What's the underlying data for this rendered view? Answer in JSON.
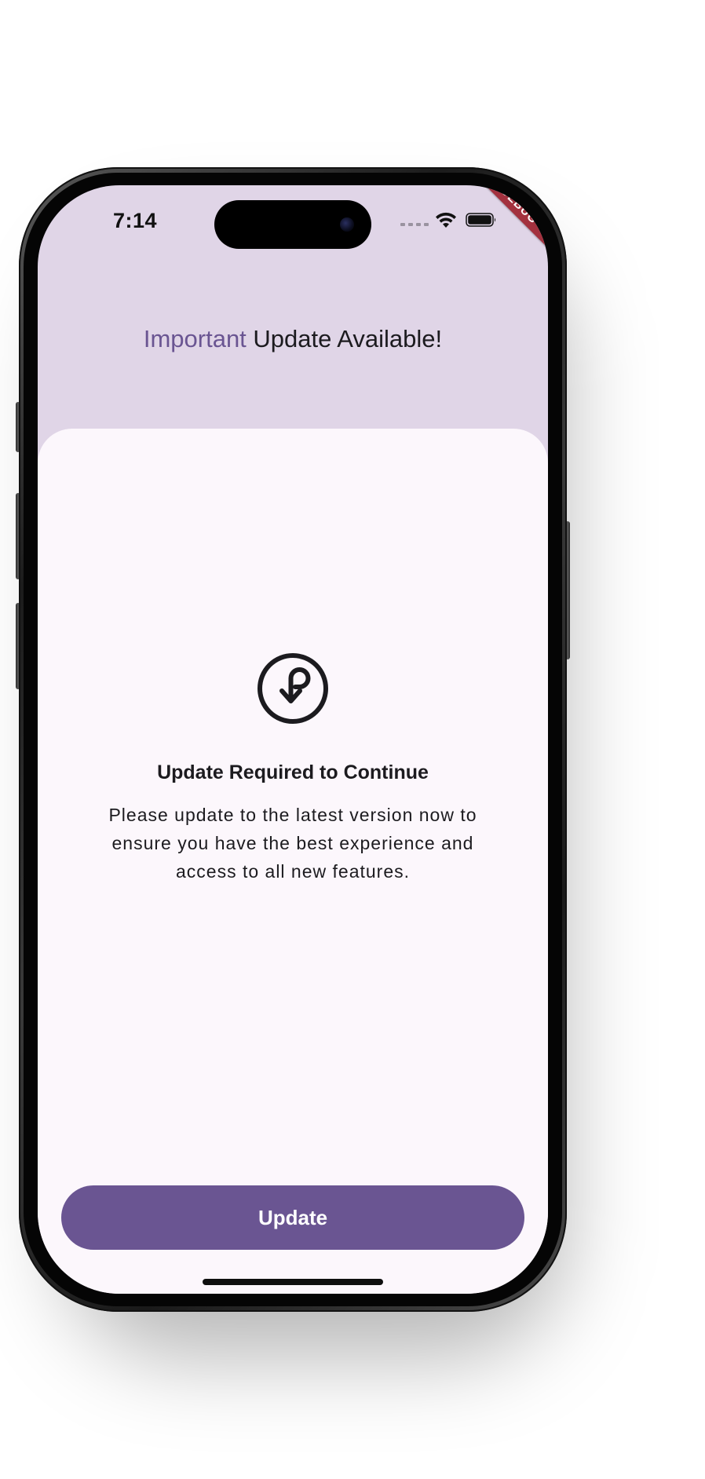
{
  "status_bar": {
    "time": "7:14",
    "debug_label": "DEBUG",
    "icons": [
      "cellular-signal-icon",
      "wifi-icon",
      "battery-icon"
    ]
  },
  "header": {
    "title_accent": "Important",
    "title_rest": " Update Available!"
  },
  "content": {
    "icon": "update-download-icon",
    "subtitle": "Update Required to Continue",
    "description": "Please update to the latest version now to ensure you have the best experience and access to all new features."
  },
  "actions": {
    "update_label": "Update"
  },
  "colors": {
    "header_background": "#e0d5e7",
    "sheet_background": "#fcf7fc",
    "accent": "#6a5592",
    "text": "#1c1b1f",
    "debug_ribbon": "#a3313e"
  }
}
